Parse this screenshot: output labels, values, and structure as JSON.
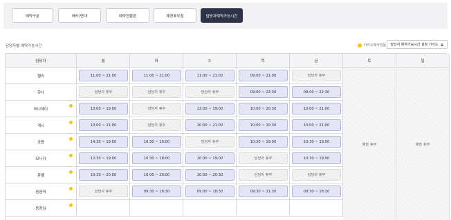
{
  "tabs": [
    {
      "label": "예약구분"
    },
    {
      "label": "배드/연대"
    },
    {
      "label": "예약현황판"
    },
    {
      "label": "예정표무침"
    },
    {
      "label": "담당자예약가능시간",
      "active": true
    }
  ],
  "section_title": "담당자별 예약가능시간",
  "legend_label": "카카오예약연동",
  "setting_button": {
    "label": "담당자 예약가능시간 설정 가이드",
    "icon": "download-arrow-icon"
  },
  "table": {
    "staff_header": "담당자",
    "days": [
      "월",
      "화",
      "수",
      "목",
      "금",
      "토",
      "일"
    ],
    "weekend_off_label": "매장 휴무",
    "rows": [
      {
        "name": "헬리",
        "kakao": false,
        "slots": [
          {
            "text": "11:00 ~ 21:00",
            "type": "avail"
          },
          {
            "text": "11:00 ~ 21:00",
            "type": "avail"
          },
          {
            "text": "11:00 ~ 21:00",
            "type": "avail"
          },
          {
            "text": "09:00 ~ 21:00",
            "type": "avail"
          },
          {
            "text": "담당자 휴무",
            "type": "off"
          }
        ]
      },
      {
        "name": "하나",
        "kakao": false,
        "slots": [
          {
            "text": "담당자 휴무",
            "type": "off"
          },
          {
            "text": "담당자 휴무",
            "type": "off"
          },
          {
            "text": "담당자 휴무",
            "type": "off"
          },
          {
            "text": "09:00 ~ 22:30",
            "type": "avail"
          },
          {
            "text": "09:00 ~ 22:30",
            "type": "avail"
          }
        ]
      },
      {
        "name": "허니제이",
        "kakao": true,
        "slots": [
          {
            "text": "13:00 ~ 19:00",
            "type": "avail"
          },
          {
            "text": "담당자 휴무",
            "type": "off"
          },
          {
            "text": "13:00 ~ 19:00",
            "type": "avail"
          },
          {
            "text": "10:00 ~ 20:30",
            "type": "avail"
          },
          {
            "text": "10:00 ~ 21:00",
            "type": "avail"
          }
        ]
      },
      {
        "name": "게시",
        "kakao": true,
        "slots": [
          {
            "text": "10:00 ~ 21:00",
            "type": "avail"
          },
          {
            "text": "담당자 휴무",
            "type": "off"
          },
          {
            "text": "10:00 ~ 21:00",
            "type": "avail"
          },
          {
            "text": "10:00 ~ 20:30",
            "type": "avail"
          },
          {
            "text": "10:00 ~ 21:00",
            "type": "avail"
          }
        ]
      },
      {
        "name": "공용",
        "kakao": true,
        "slots": [
          {
            "text": "14:30 ~ 19:00",
            "type": "avail"
          },
          {
            "text": "10:30 ~ 19:00",
            "type": "avail"
          },
          {
            "text": "담당자 휴무",
            "type": "off"
          },
          {
            "text": "10:30 ~ 19:00",
            "type": "avail"
          },
          {
            "text": "10:30 ~ 19:00",
            "type": "avail"
          }
        ]
      },
      {
        "name": "모니카",
        "kakao": true,
        "slots": [
          {
            "text": "12:30 ~ 19:00",
            "type": "avail"
          },
          {
            "text": "10:30 ~ 18:00",
            "type": "avail"
          },
          {
            "text": "10:30 ~ 19:00",
            "type": "avail"
          },
          {
            "text": "담당자 휴무",
            "type": "off"
          },
          {
            "text": "10:30 ~ 19:00",
            "type": "avail"
          }
        ]
      },
      {
        "name": "휴웰",
        "kakao": true,
        "slots": [
          {
            "text": "10:30 ~ 20:00",
            "type": "avail"
          },
          {
            "text": "10:00 ~ 20:00",
            "type": "avail"
          },
          {
            "text": "10:00 ~ 20:30",
            "type": "avail"
          },
          {
            "text": "담당자 휴무",
            "type": "off"
          },
          {
            "text": "담당자 휴무",
            "type": "off"
          }
        ]
      },
      {
        "name": "송송석",
        "kakao": true,
        "slots": [
          {
            "text": "담당자 휴무",
            "type": "off"
          },
          {
            "text": "09:30 ~ 18:30",
            "type": "avail"
          },
          {
            "text": "09:30 ~ 18:30",
            "type": "avail"
          },
          {
            "text": "09:30 ~ 21:30",
            "type": "avail"
          },
          {
            "text": "09:30 ~ 18:30",
            "type": "avail"
          }
        ]
      },
      {
        "name": "등장님",
        "kakao": true,
        "slots": [
          {
            "text": "",
            "type": "empty"
          },
          {
            "text": "",
            "type": "empty"
          },
          {
            "text": "",
            "type": "empty"
          },
          {
            "text": "",
            "type": "empty"
          },
          {
            "text": "",
            "type": "empty"
          }
        ]
      }
    ]
  },
  "colors": {
    "accent": "#2d3447",
    "kakao_dot": "#f5c518",
    "slot_fill": "#e4e5f6",
    "slot_border": "#b4b6d8"
  }
}
